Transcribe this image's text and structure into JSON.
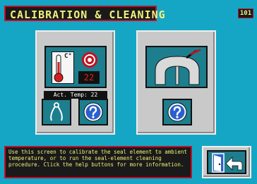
{
  "header": {
    "title": "CALIBRATION & CLEANING",
    "screen_number": "101"
  },
  "calibration_panel": {
    "temperature_tile": {
      "unit_label": "C°",
      "readout": "22"
    },
    "actual_temp_label": "Act. Temp: 22",
    "icons": [
      "thermometer-icon",
      "seal-element-icon",
      "calipers-icon",
      "help-icon"
    ]
  },
  "cleaning_panel": {
    "icons": [
      "seal-cleaning-icon",
      "help-icon"
    ]
  },
  "info": {
    "text": "Use this screen to calibrate the seal element to ambient temperature, or to run the seal-element cleaning procedure. Click the help buttons for more information."
  },
  "exit": {
    "icons": [
      "door-exit-icon",
      "back-arrow-icon"
    ]
  },
  "colors": {
    "background": "#15a6c6",
    "panel": "#c9c9c9",
    "tile": "#1d7e8e",
    "text_yellow": "#f2f07a",
    "border_red": "#c0102a"
  }
}
